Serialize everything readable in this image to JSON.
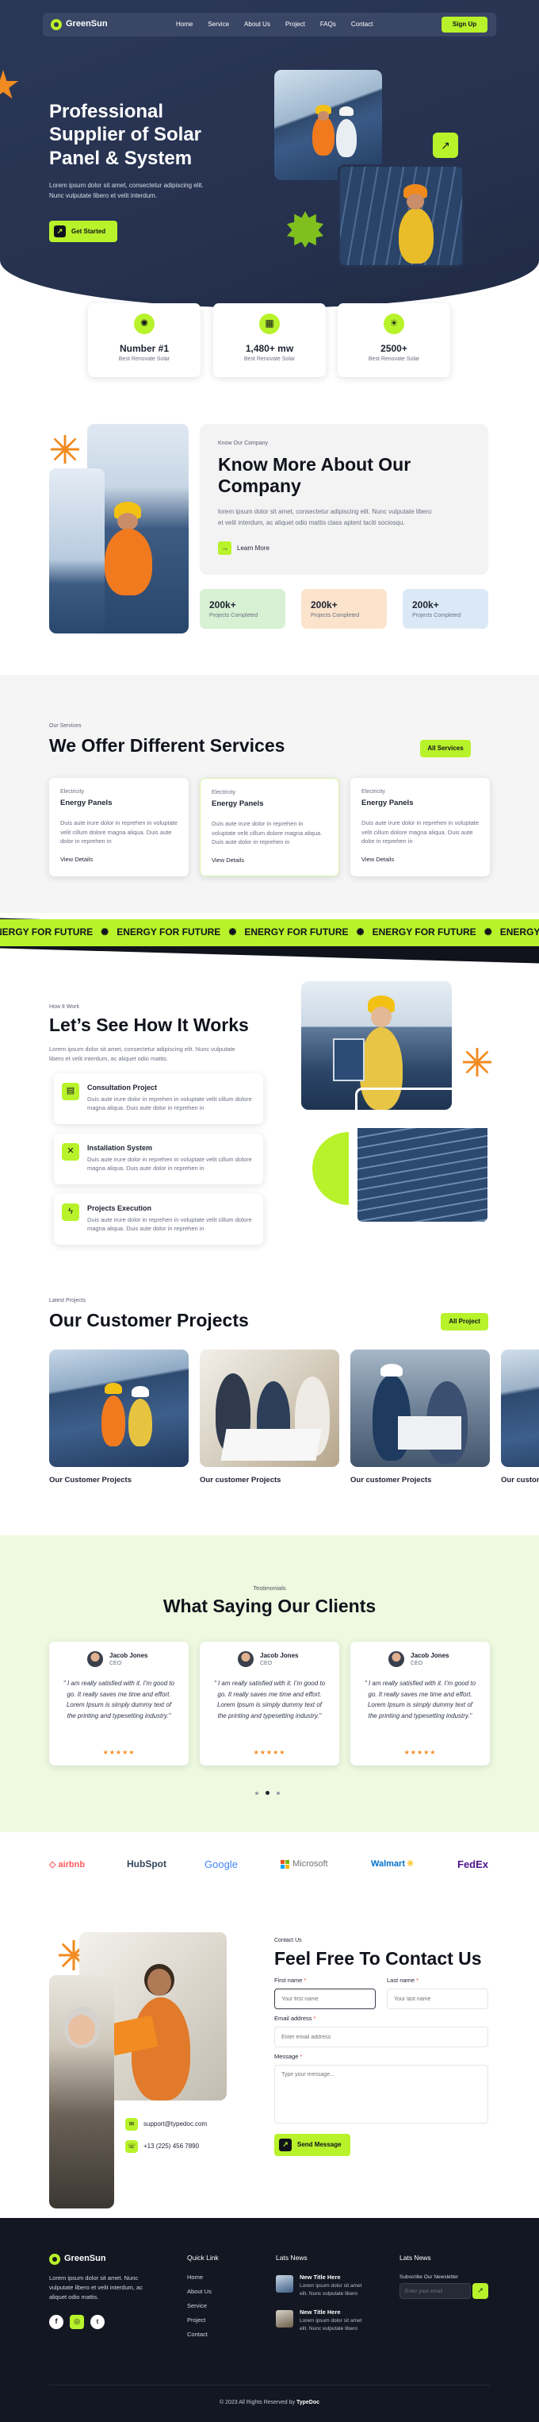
{
  "brand": {
    "name": "GreenSun"
  },
  "nav": {
    "items": [
      "Home",
      "Service",
      "About Us",
      "Project",
      "FAQs",
      "Contact"
    ],
    "cta": "Sign Up"
  },
  "hero": {
    "title_line1": "Professional",
    "title_line2": "Supplier of Solar",
    "title_line3": "Panel & System",
    "text_line1": "Lorem ipsum dolor sit amet, consectetur adipiscing elit.",
    "text_line2": "Nunc vulputate libero et velit interdum.",
    "cta": "Get Started"
  },
  "stats": [
    {
      "value": "Number #1",
      "label": "Best Renovate Solar"
    },
    {
      "value": "1,480+ mw",
      "label": "Best Renovate Solar"
    },
    {
      "value": "2500+",
      "label": "Best Renovate Solar"
    }
  ],
  "about": {
    "eyebrow": "Know Our Company",
    "title_line1": "Know More About Our",
    "title_line2": "Company",
    "text_line1": "lorem ipsum dolor sit amet, consectetur adipiscing elit. Nunc vulputate libero",
    "text_line2": "et velit interdum, ac aliquet odio mattis class aptent taciti sociosqu.",
    "link": "Learn More",
    "counters": [
      {
        "value": "200k+",
        "label": "Projects Completed",
        "color": "#d8f0d4"
      },
      {
        "value": "200k+",
        "label": "Projects Completed",
        "color": "#fbe3cc"
      },
      {
        "value": "200k+",
        "label": "Projects Completed",
        "color": "#dbe9f6"
      }
    ]
  },
  "services": {
    "eyebrow": "Our Services",
    "title": "We Offer Different Services",
    "cta": "All Services",
    "cards": [
      {
        "tag": "Electricity",
        "title": "Energy Panels",
        "text": "Duis aute irure dolor in reprehen in voluptate velit cillum dolore magna aliqua. Duis aute dolor in reprehen in",
        "link": "View Details"
      },
      {
        "tag": "Electricity",
        "title": "Energy Panels",
        "text": "Duis aute irure dolor in reprehen in voluptate velit cillum dolore magna aliqua. Duis aute dolor in reprehen in",
        "link": "View Details"
      },
      {
        "tag": "Electricity",
        "title": "Energy Panels",
        "text": "Duis aute irure dolor in reprehen in voluptate velit cillum dolore magna aliqua. Duis aute dolor in reprehen in",
        "link": "View Details"
      }
    ]
  },
  "ticker": {
    "text": "ENERGY FOR FUTURE"
  },
  "how": {
    "eyebrow": "How It Work",
    "title": "Let’s See How It Works",
    "text_line1": "Lorem ipsum dolor sit amet, consectetur adipiscing elit. Nunc vulputate",
    "text_line2": "libero et velit interdum, ac aliquet odio mattis.",
    "steps": [
      {
        "title": "Consultation Project",
        "text": "Duis aute irure dolor in reprehen in voluptate velit cillum dolore magna aliqua. Duis aute dolor in reprehen in",
        "icon": "document-icon"
      },
      {
        "title": "Installation System",
        "text": "Duis aute irure dolor in reprehen in voluptate velit cillum dolore magna aliqua. Duis aute dolor in reprehen in",
        "icon": "tools-icon"
      },
      {
        "title": "Projects Execution",
        "text": "Duis aute irure dolor in reprehen in voluptate velit cillum dolore magna aliqua. Duis aute dolor in reprehen in",
        "icon": "bolt-icon"
      }
    ]
  },
  "projects": {
    "eyebrow": "Latest Projects",
    "title": "Our Customer Projects",
    "cta": "All Project",
    "items": [
      "Our Customer Projects",
      "Our customer Projects",
      "Our customer Projects",
      "Our custom"
    ]
  },
  "testimonials": {
    "eyebrow": "Testimonials",
    "title": "What Saying Our Clients",
    "items": [
      {
        "name": "Jacob Jones",
        "role": "CEO",
        "quote": "\" I am really satisfied with it. I’m good to go. It really saves me time and effort. Lorem Ipsum is simply dummy text of the printing and typesetting industry.\"",
        "stars": "★★★★★"
      },
      {
        "name": "Jacob Jones",
        "role": "CEO",
        "quote": "\" I am really satisfied with it. I’m good to go. It really saves me time and effort. Lorem Ipsum is simply dummy text of the printing and typesetting industry.\"",
        "stars": "★★★★★"
      },
      {
        "name": "Jacob Jones",
        "role": "CEO",
        "quote": "\" I am really satisfied with it. I’m good to go. It really saves me time and effort. Lorem Ipsum is simply dummy text of the printing and typesetting industry.\"",
        "stars": "★★★★★"
      }
    ]
  },
  "logos": [
    "airbnb",
    "HubSpot",
    "Google",
    "Microsoft",
    "Walmart",
    "FedEx"
  ],
  "contact": {
    "eyebrow": "Contact Us",
    "title": "Feel Free To Contact Us",
    "first_label": "First name",
    "first_placeholder": "Your first name",
    "last_label": "Last name",
    "last_placeholder": "Your last name",
    "email_label": "Email address",
    "email_placeholder": "Enter email address",
    "message_label": "Message",
    "message_placeholder": "Type your message...",
    "required": "*",
    "submit": "Send Message",
    "email": "support@typedoc.com",
    "phone": "+13 (225) 456 7890"
  },
  "footer": {
    "brand": "GreenSun",
    "about_line1": "Lorem ipsum dolor sit amet. Nunc",
    "about_line2": "vulputate libero et velit interdum, ac",
    "about_line3": "aliquet odio mattis.",
    "quick_title": "Quick Link",
    "quick_links": [
      "Home",
      "About Us",
      "Service",
      "Project",
      "Contact"
    ],
    "news_title": "Lats News",
    "news": [
      {
        "title": "New Title Here",
        "text_line1": "Lorem ipsum dolor sit amet",
        "text_line2": "elit. Nunc vulputate libero"
      },
      {
        "title": "New Title Here",
        "text_line1": "Lorem ipsum dolor sit amet",
        "text_line2": "elit. Nunc vulputate libero"
      }
    ],
    "newsletter_title": "Lats News",
    "newsletter_label": "Subscribe Our Newsletter",
    "newsletter_placeholder": "Enter your email",
    "copyright": "© 2023 All Rights Reserved by ",
    "copyright_brand": "TypeDoc"
  },
  "colors": {
    "navy": "#2a3654",
    "lime": "#b8f22a",
    "orange": "#f28b21",
    "dark": "#131722"
  }
}
